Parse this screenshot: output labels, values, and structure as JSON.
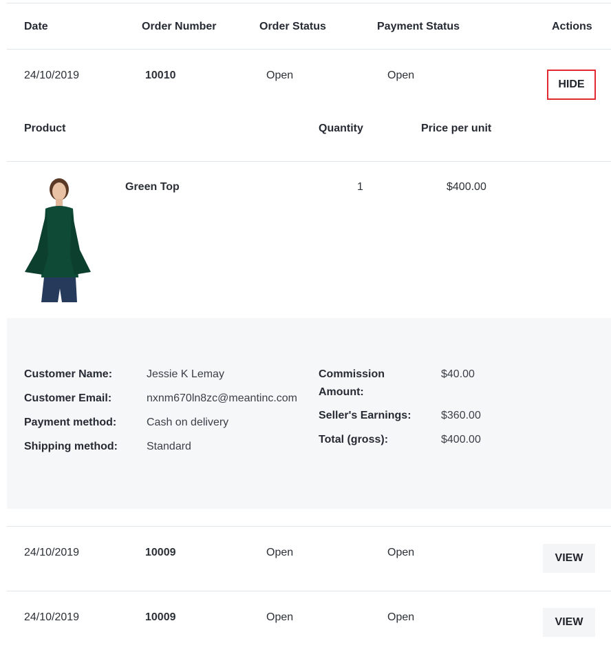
{
  "table_header": {
    "date": "Date",
    "order_number": "Order Number",
    "order_status": "Order Status",
    "payment_status": "Payment Status",
    "actions": "Actions"
  },
  "orders": [
    {
      "date": "24/10/2019",
      "number": "10010",
      "order_status": "Open",
      "payment_status": "Open",
      "action": "HIDE"
    },
    {
      "date": "24/10/2019",
      "number": "10009",
      "order_status": "Open",
      "payment_status": "Open",
      "action": "VIEW"
    },
    {
      "date": "24/10/2019",
      "number": "10009",
      "order_status": "Open",
      "payment_status": "Open",
      "action": "VIEW"
    }
  ],
  "product_header": {
    "product": "Product",
    "quantity": "Quantity",
    "price": "Price per unit"
  },
  "product": {
    "name": "Green Top",
    "quantity": "1",
    "price": "$400.00",
    "image_icon": "green-top-photo"
  },
  "details": {
    "customer_name_label": "Customer Name:",
    "customer_name": "Jessie K Lemay",
    "customer_email_label": "Customer Email:",
    "customer_email": "nxnm670ln8zc@meantinc.com",
    "payment_method_label": "Payment method:",
    "payment_method": "Cash on delivery",
    "shipping_method_label": "Shipping method:",
    "shipping_method": "Standard",
    "commission_label_1": "Commission",
    "commission_label_2": "Amount:",
    "commission": "$40.00",
    "seller_earnings_label": "Seller's Earnings:",
    "seller_earnings": "$360.00",
    "total_label": "Total (gross):",
    "total": "$400.00"
  },
  "colors": {
    "hide_border": "#e0282e",
    "top_green": "#0f4a37",
    "panel_bg": "#f6f7f9",
    "divider": "#dfe5e8"
  }
}
